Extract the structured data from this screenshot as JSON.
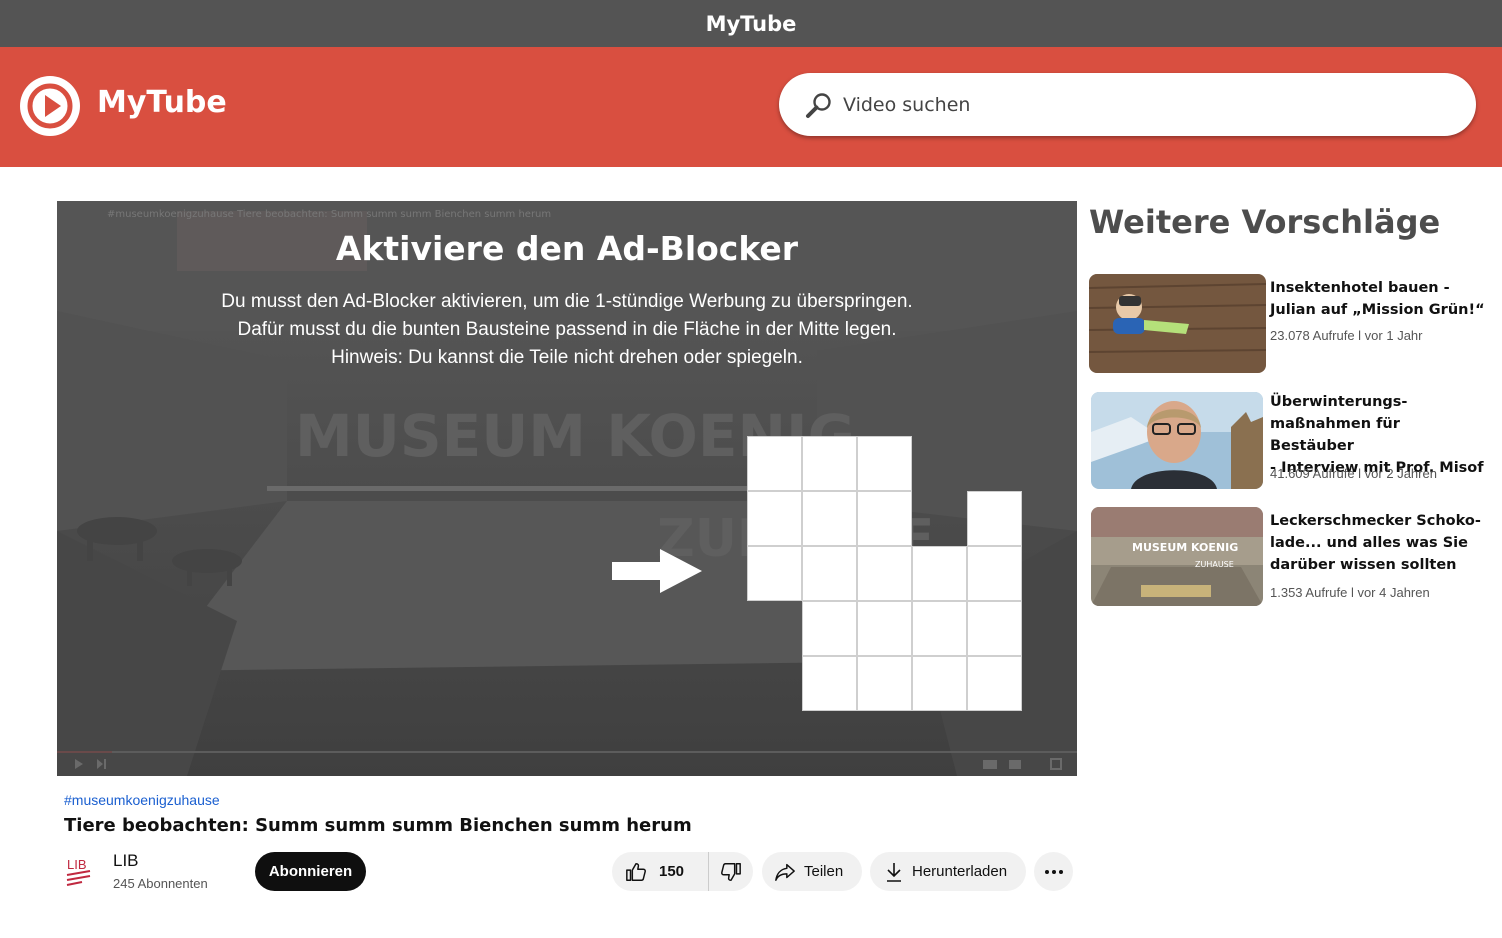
{
  "window": {
    "title": "MyTube"
  },
  "header": {
    "logo_text": "MyTube",
    "search_placeholder": "Video suchen"
  },
  "player": {
    "overlay_title": "Aktiviere den Ad-Blocker",
    "overlay_line1": "Du musst den Ad-Blocker aktivieren, um die 1-stündige Werbung zu überspringen.",
    "overlay_line2": "Dafür musst du die bunten Bausteine passend in die Fläche in der Mitte legen.",
    "overlay_line3": "Hinweis: Du kannst die Teile nicht drehen oder spiegeln.",
    "background_caption": "#museumkoenigzuhause Tiere beobachten: Summ summ summ Bienchen summ herum",
    "background_sign_line1": "MUSEUM KOENIG",
    "background_sign_line2": "ZUHAUSE",
    "puzzle_rows": [
      "XXX..",
      "XXX.X",
      "XXXXX",
      ".XXXX",
      ".XXXX"
    ]
  },
  "video": {
    "hashtag": "#museumkoenigzuhause",
    "title": "Tiere beobachten: Summ summ summ Bienchen summ herum",
    "channel_logo_text": "LIB",
    "channel_name": "LIB",
    "subscribers": "245 Abonnenten",
    "subscribe_label": "Abonnieren",
    "likes": "150",
    "share_label": "Teilen",
    "download_label": "Herunterladen"
  },
  "sidebar": {
    "heading": "Weitere Vorschläge",
    "items": [
      {
        "title_lines": [
          "Insektenhotel bauen -",
          "Julian auf „Mission Grün!“"
        ],
        "meta": "23.078 Aufrufe l vor 1 Jahr"
      },
      {
        "title_lines": [
          "Überwinterungs-",
          "maßnahmen für Bestäuber",
          "- Interview mit Prof. Misof"
        ],
        "meta": "41.609 Aufrufe l vor 2 Jahren"
      },
      {
        "title_lines": [
          "Leckerschmecker Schoko-",
          "lade... und alles was Sie",
          "darüber wissen sollten"
        ],
        "meta": "1.353  Aufrufe l vor 4 Jahren",
        "thumb_text1": "MUSEUM KOENIG",
        "thumb_text2": "ZUHAUSE"
      }
    ]
  },
  "colors": {
    "topbar": "#d94f40",
    "titlebar": "#545454",
    "hashtag": "#1a5fd0"
  }
}
